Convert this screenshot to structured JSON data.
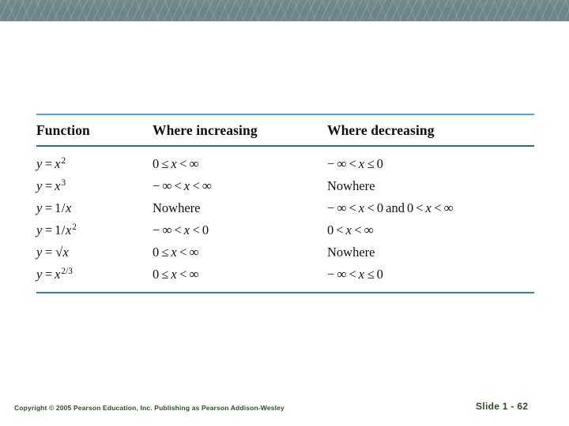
{
  "slide": {
    "banner": {
      "color": "#6f8688"
    },
    "background_color": "#ffffff"
  },
  "table": {
    "rule_colors": {
      "top": "#49a8cd",
      "middle": "#1d6f80",
      "bottom": "#2a8aa6"
    },
    "headers": {
      "function": "Function",
      "increasing": "Where increasing",
      "decreasing": "Where decreasing"
    },
    "rows": [
      {
        "function_plain": "y = x²",
        "increasing_plain": "0 ≤ x < ∞",
        "decreasing_plain": "−∞ < x ≤ 0"
      },
      {
        "function_plain": "y = x³",
        "increasing_plain": "−∞ < x < ∞",
        "decreasing_plain": "Nowhere"
      },
      {
        "function_plain": "y = 1/x",
        "increasing_plain": "Nowhere",
        "decreasing_plain": "−∞ < x < 0 and 0 < x < ∞"
      },
      {
        "function_plain": "y = 1/x²",
        "increasing_plain": "−∞ < x < 0",
        "decreasing_plain": "0 < x < ∞"
      },
      {
        "function_plain": "y = √x",
        "increasing_plain": "0 ≤ x < ∞",
        "decreasing_plain": "Nowhere"
      },
      {
        "function_plain": "y = x^(2/3)",
        "increasing_plain": "0 ≤ x < ∞",
        "decreasing_plain": "−∞ < x ≤ 0"
      }
    ]
  },
  "footer": {
    "copyright": "Copyright © 2005 Pearson Education, Inc.  Publishing as Pearson Addison-Wesley",
    "slide_number": "Slide 1 - 62",
    "text_color": "#2f4f1f"
  }
}
